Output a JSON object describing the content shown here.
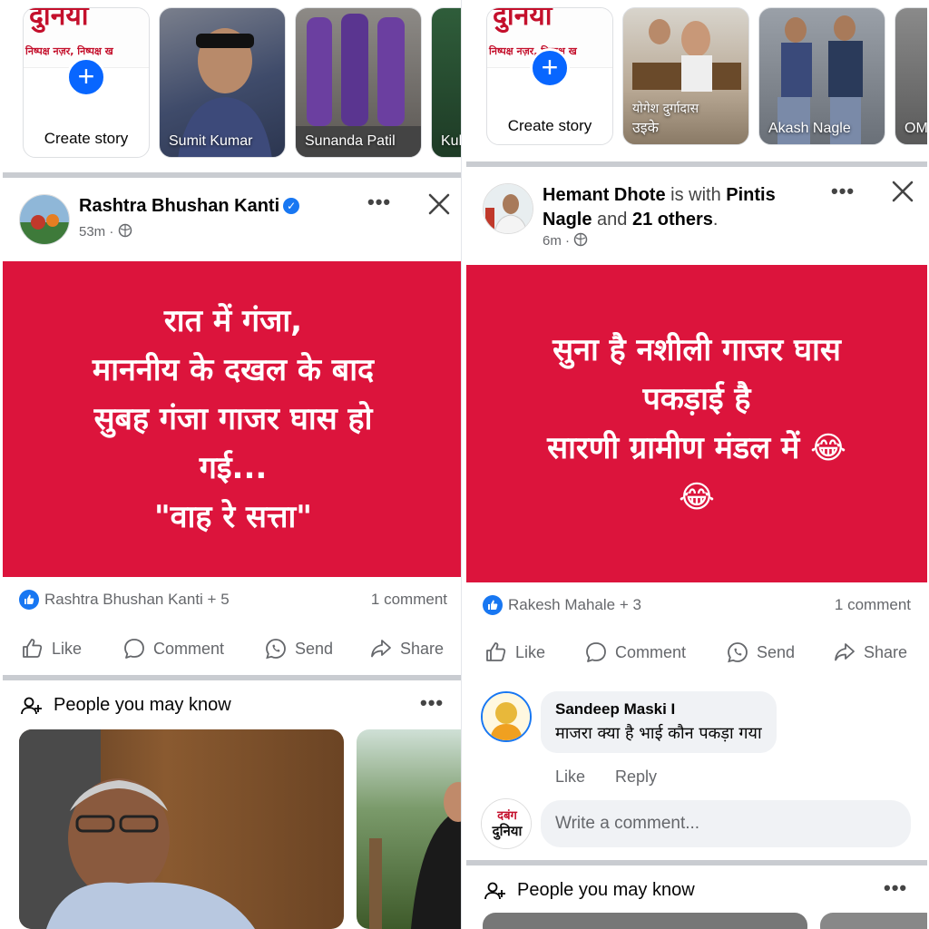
{
  "left": {
    "stories": {
      "create_label": "Create story",
      "banner_title": "दुनिया",
      "banner_sub": "निष्पक्ष नज़र, निष्पक्ष ख",
      "items": [
        {
          "name": "Sumit Kumar",
          "caption": ""
        },
        {
          "name": "Sunanda Patil",
          "caption": ""
        },
        {
          "name": "Kul",
          "caption": ""
        }
      ]
    },
    "post": {
      "author": "Rashtra Bhushan Kanti",
      "time": "53m ·",
      "text": "रात में गंजा,\nमाननीय के दखल के बाद\nसुबह गंजा गाजर घास हो\nगई...\n\"वाह रे सत्ता\"",
      "reactors": "Rashtra Bhushan Kanti + 5",
      "comments": "1 comment",
      "bg_color": "#dc143c"
    },
    "actions": {
      "like": "Like",
      "comment": "Comment",
      "send": "Send",
      "share": "Share"
    },
    "pymk": {
      "title": "People you may know"
    }
  },
  "right": {
    "stories": {
      "create_label": "Create story",
      "banner_sub": "निष्पक्ष नज़र, निष्पक्ष ख",
      "items": [
        {
          "name": "उइके",
          "caption": "योगेश दुर्गादास"
        },
        {
          "name": "Akash Nagle",
          "caption": ""
        },
        {
          "name": "OM",
          "caption": ""
        }
      ]
    },
    "post": {
      "author": "Hemant Dhote",
      "with_word": " is with ",
      "tagged": "Pintis",
      "tagged2": "Nagle",
      "and_word": " and ",
      "others": "21 others",
      "period": ".",
      "time": "6m ·",
      "text": "सुना है नशीली गाजर घास\nपकड़ाई है\nसारणी ग्रामीण मंडल में 😂\n😂",
      "reactors": "Rakesh Mahale + 3",
      "comments": "1 comment",
      "bg_color": "#dc143c"
    },
    "actions": {
      "like": "Like",
      "comment": "Comment",
      "send": "Send",
      "share": "Share"
    },
    "comment": {
      "name": "Sandeep Maski I",
      "text": "माजरा क्या है भाई कौन पकड़ा गया",
      "like": "Like",
      "reply": "Reply"
    },
    "write": {
      "placeholder": "Write a comment..."
    },
    "pymk": {
      "title": "People you may know"
    }
  },
  "colors": {
    "accent": "#0866ff",
    "post_bg": "#dc143c",
    "muted": "#65676b"
  }
}
